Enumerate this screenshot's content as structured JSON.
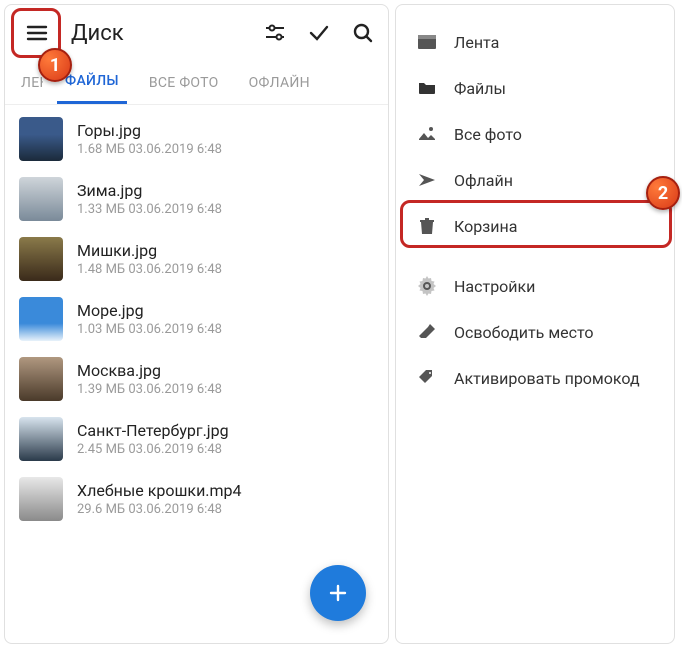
{
  "app": {
    "title": "Диск"
  },
  "tabs": {
    "cut": "ЛЕНТА",
    "files": "ФАЙЛЫ",
    "photos": "ВСЕ ФОТО",
    "offline": "ОФЛАЙН"
  },
  "files": [
    {
      "name": "Горы.jpg",
      "meta": "1.68 МБ 03.06.2019 6:48"
    },
    {
      "name": "Зима.jpg",
      "meta": "1.33 МБ 03.06.2019 6:48"
    },
    {
      "name": "Мишки.jpg",
      "meta": "1.48 МБ 03.06.2019 6:48"
    },
    {
      "name": "Море.jpg",
      "meta": "1.03 МБ 03.06.2019 6:48"
    },
    {
      "name": "Москва.jpg",
      "meta": "1.39 МБ 03.06.2019 6:48"
    },
    {
      "name": "Санкт-Петербург.jpg",
      "meta": "2.45 МБ 03.06.2019 6:48"
    },
    {
      "name": "Хлебные крошки.mp4",
      "meta": "29.6 МБ 03.06.2019 6:48"
    }
  ],
  "drawer": {
    "feed": "Лента",
    "files": "Файлы",
    "photos": "Все фото",
    "offline": "Офлайн",
    "trash": "Корзина",
    "settings": "Настройки",
    "free_space": "Освободить место",
    "promo": "Активировать промокод"
  },
  "callouts": {
    "one": "1",
    "two": "2"
  }
}
